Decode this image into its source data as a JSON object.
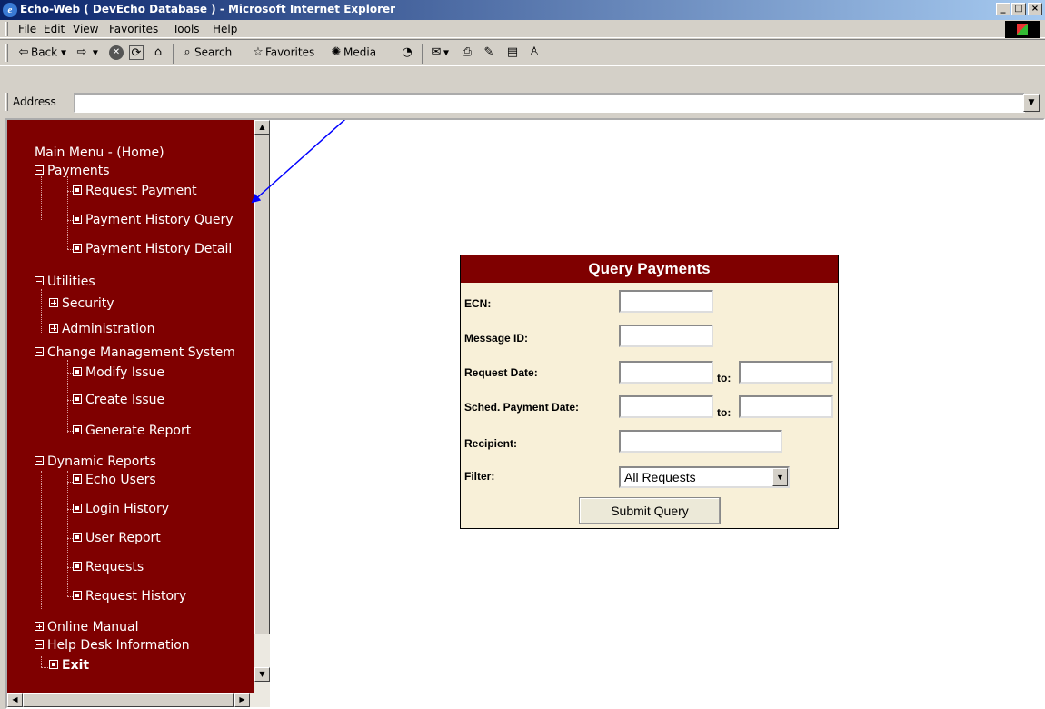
{
  "window": {
    "title": "Echo-Web ( DevEcho Database ) - Microsoft Internet Explorer",
    "minimize": "_",
    "maximize": "□",
    "close": "×"
  },
  "menubar": {
    "items": [
      "File",
      "Edit",
      "View",
      "Favorites",
      "Tools",
      "Help"
    ]
  },
  "toolbar": {
    "back": "Back",
    "search": "Search",
    "favorites": "Favorites",
    "media": "Media"
  },
  "address": {
    "label": "Address",
    "value": ""
  },
  "nav": {
    "main_menu": "Main Menu - (Home)",
    "payments": "Payments",
    "request_payment": "Request Payment",
    "payment_history_query": "Payment History Query",
    "payment_history_detail": "Payment History Detail",
    "utilities": "Utilities",
    "security": "Security",
    "administration": "Administration",
    "change_management": "Change Management System",
    "modify_issue": "Modify Issue",
    "create_issue": "Create Issue",
    "generate_report": "Generate Report",
    "dynamic_reports": "Dynamic Reports",
    "echo_users": "Echo Users",
    "login_history": "Login History",
    "user_report": "User Report",
    "requests": "Requests",
    "request_history": "Request History",
    "online_manual": "Online Manual",
    "help_desk": "Help Desk Information",
    "exit": "Exit"
  },
  "query": {
    "title": "Query Payments",
    "ecn_label": "ECN:",
    "message_id_label": "Message ID:",
    "request_date_label": "Request Date:",
    "sched_payment_label": "Sched. Payment Date:",
    "recipient_label": "Recipient:",
    "filter_label": "Filter:",
    "to_label": "to:",
    "filter_value": "All Requests",
    "submit_label": "Submit Query"
  },
  "colors": {
    "nav_bg": "#7f0000",
    "form_bg": "#f8f0d8",
    "arrow": "#0000ff"
  }
}
